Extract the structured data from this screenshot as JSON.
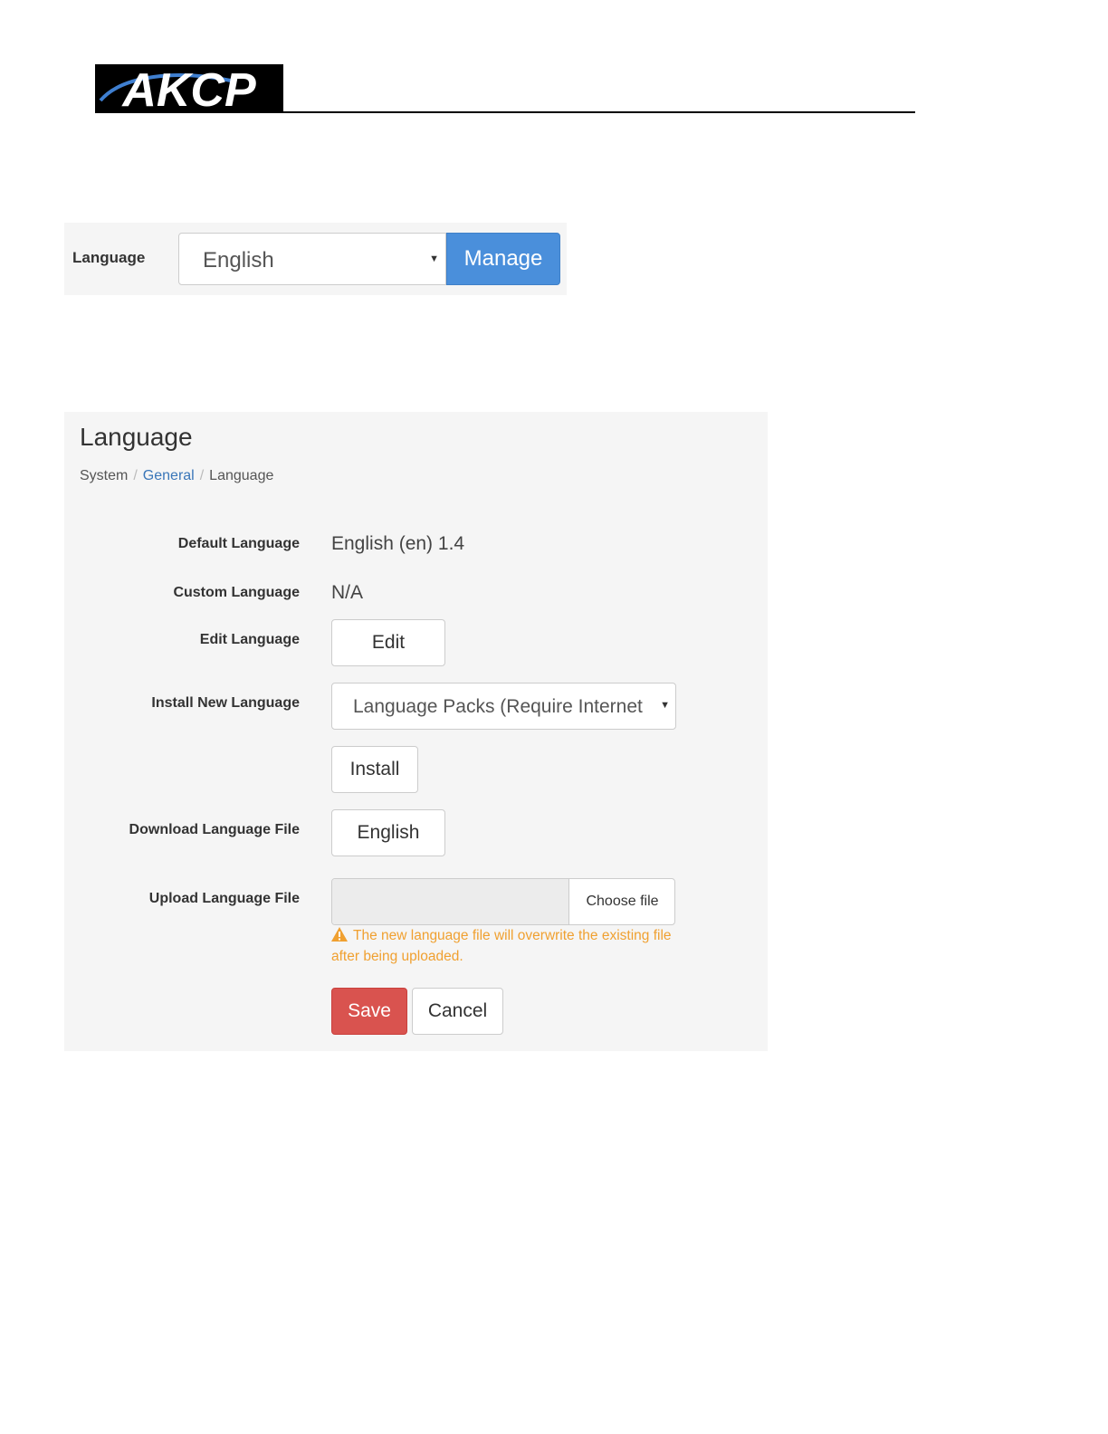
{
  "header": {
    "logo_text": "AKCP"
  },
  "language_widget": {
    "label": "Language",
    "selected_value": "English",
    "manage_label": "Manage",
    "accent_color": "#4a8fdb"
  },
  "page": {
    "title": "Language",
    "breadcrumb": {
      "items": [
        {
          "label": "System"
        },
        {
          "label": "General"
        },
        {
          "label": "Language"
        }
      ],
      "separator": "/"
    },
    "fields": {
      "default_language": {
        "label": "Default Language",
        "value": "English (en) 1.4"
      },
      "custom_language": {
        "label": "Custom Language",
        "value": "N/A"
      },
      "edit_language": {
        "label": "Edit Language",
        "button_label": "Edit"
      },
      "install_new_language": {
        "label": "Install New Language",
        "selected_option": "Language Packs (Require Internet",
        "install_button_label": "Install"
      },
      "download_language_file": {
        "label": "Download Language File",
        "button_label": "English"
      },
      "upload_language_file": {
        "label": "Upload Language File",
        "choose_file_label": "Choose file",
        "warning": "The new language file will overwrite the existing file after being uploaded."
      }
    },
    "actions": {
      "save_label": "Save",
      "cancel_label": "Cancel"
    },
    "colors": {
      "save": "#d9534f",
      "warning": "#f0a030",
      "link": "#3a76b8"
    }
  }
}
